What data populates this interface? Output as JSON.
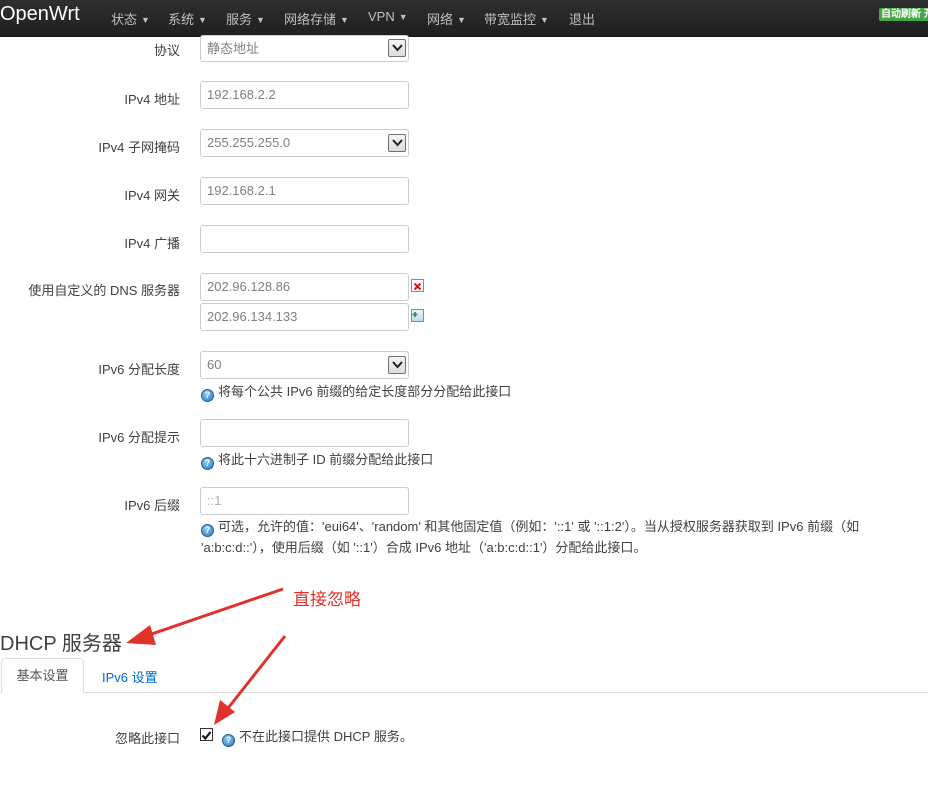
{
  "navbar": {
    "brand": "OpenWrt",
    "menu": [
      "状态",
      "系统",
      "服务",
      "网络存储",
      "VPN",
      "网络",
      "带宽监控"
    ],
    "logout": "退出",
    "auto_refresh": "自动刷新 开"
  },
  "form": {
    "protocol": {
      "label": "协议",
      "value": "静态地址"
    },
    "ipv4_address": {
      "label": "IPv4 地址",
      "value": "192.168.2.2"
    },
    "ipv4_netmask": {
      "label": "IPv4 子网掩码",
      "value": "255.255.255.0"
    },
    "ipv4_gateway": {
      "label": "IPv4 网关",
      "value": "192.168.2.1"
    },
    "ipv4_broadcast": {
      "label": "IPv4 广播",
      "value": ""
    },
    "dns": {
      "label": "使用自定义的 DNS 服务器",
      "values": [
        "202.96.128.86",
        "202.96.134.133"
      ]
    },
    "ipv6_assign_length": {
      "label": "IPv6 分配长度",
      "value": "60",
      "help": "将每个公共 IPv6 前缀的给定长度部分分配给此接口"
    },
    "ipv6_assign_hint": {
      "label": "IPv6 分配提示",
      "value": "",
      "help": "将此十六进制子 ID 前缀分配给此接口"
    },
    "ipv6_suffix": {
      "label": "IPv6 后缀",
      "placeholder": "::1",
      "help_line1": "可选，允许的值：'eui64'、'random' 和其他固定值（例如：'::1' 或 '::1:2'）。当从授权服务器获取到 IPv6 前缀（如",
      "help_line2": "'a:b:c:d::'），使用后缀（如 '::1'）合成 IPv6 地址（'a:b:c:d::1'）分配给此接口。"
    }
  },
  "dhcp": {
    "title": "DHCP 服务器",
    "tabs": [
      "基本设置",
      "IPv6 设置"
    ],
    "ignore": {
      "label": "忽略此接口",
      "checked": true,
      "help": "不在此接口提供 DHCP 服务。"
    }
  },
  "annotation": "直接忽略",
  "colors": {
    "navbar": "#222222",
    "link": "#0069d6",
    "annotation": "#e0322b",
    "refresh_badge": "#46a546"
  },
  "icons": [
    "caret-down-icon",
    "dropdown-arrow-icon",
    "delete-icon",
    "add-icon",
    "help-icon",
    "checkmark-icon",
    "arrow-icon"
  ]
}
